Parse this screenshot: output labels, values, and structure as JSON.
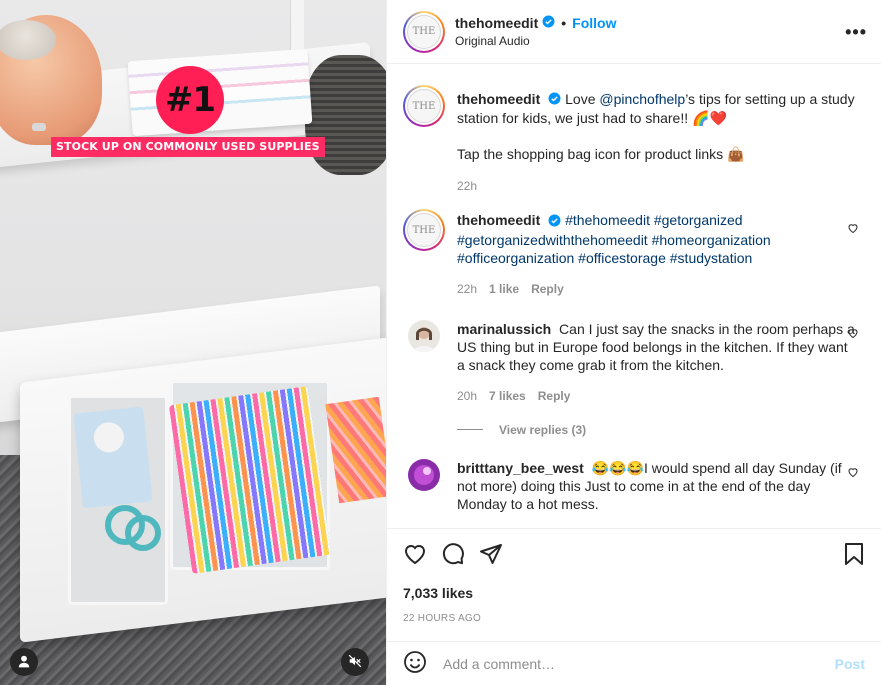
{
  "media": {
    "badge_text": "#1",
    "caption_banner": "STOCK UP ON COMMONLY USED SUPPLIES"
  },
  "header": {
    "username": "thehomeedit",
    "separator": "•",
    "follow_label": "Follow",
    "audio_label": "Original Audio",
    "more_label": "•••",
    "avatar_monogram": "THE"
  },
  "comments": [
    {
      "username": "thehomeedit",
      "text_before_link": "Love ",
      "link": "@pinchofhelp",
      "text_after_link": "’s tips for setting up a study station for kids, we just had to share!! 🌈❤️",
      "second_paragraph": "Tap the shopping bag icon for product links 👜",
      "time": "22h"
    },
    {
      "username": "thehomeedit",
      "hashtags": [
        "#thehomeedit",
        "#getorganized",
        "#getorganizedwiththehomeedit",
        "#homeorganization",
        "#officeorganization",
        "#officestorage",
        "#studystation"
      ],
      "time": "22h",
      "likes": "1 like",
      "reply": "Reply"
    },
    {
      "username": "marinalussich",
      "text": "Can I just say the snacks in the room perhaps a US thing but in Europe food belongs in the kitchen. If they want a snack they come grab it from the kitchen.",
      "time": "20h",
      "likes": "7 likes",
      "reply": "Reply",
      "view_replies": "View replies (3)"
    },
    {
      "username": "britttany_bee_west",
      "text": "😂😂😂I would spend all day Sunday (if not more) doing this Just to come in at the end of the day Monday to a hot mess."
    }
  ],
  "footer": {
    "likes_count": "7,033 likes",
    "time_ago": "22 HOURS AGO",
    "comment_placeholder": "Add a comment…",
    "post_label": "Post"
  },
  "colors": {
    "accent_blue": "#0095f6",
    "link_blue": "#00376b",
    "muted": "#8e8e8e",
    "banner_pink": "#ff2b63"
  }
}
